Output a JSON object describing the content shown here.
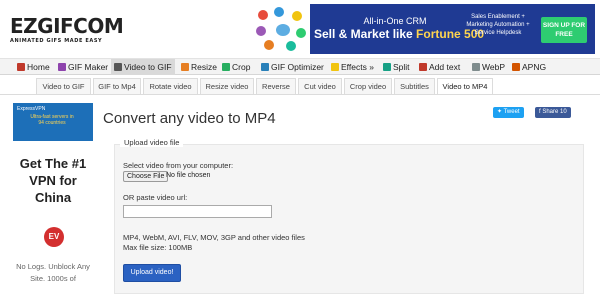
{
  "logo": {
    "text": "EZGIFCOM",
    "tagline": "ANIMATED GIFS MADE EASY"
  },
  "ad_banner": {
    "line1": "All-in-One CRM",
    "line2_prefix": "Sell & Market like ",
    "line2_highlight": "Fortune 500",
    "side_lines": [
      "Sales Enablement +",
      "Marketing Automation +",
      "Service Helpdesk"
    ],
    "cta": "SIGN UP FOR FREE",
    "colors": {
      "bg": "#1f3a93",
      "cta": "#2ecc71",
      "highlight": "#ffd54f"
    }
  },
  "main_nav": [
    {
      "label": "Home",
      "icon": "home-icon",
      "color": "#c0392b"
    },
    {
      "label": "GIF Maker",
      "icon": "gif-maker-icon",
      "color": "#8e44ad"
    },
    {
      "label": "Video to GIF",
      "icon": "video-icon",
      "color": "#555555",
      "active": true
    },
    {
      "label": "Resize",
      "icon": "resize-icon",
      "color": "#e67e22"
    },
    {
      "label": "Crop",
      "icon": "crop-icon",
      "color": "#27ae60"
    },
    {
      "label": "GIF Optimizer",
      "icon": "optimizer-icon",
      "color": "#2980b9"
    },
    {
      "label": "Effects »",
      "icon": "effects-icon",
      "color": "#f1c40f"
    },
    {
      "label": "Split",
      "icon": "split-icon",
      "color": "#16a085"
    },
    {
      "label": "Add text",
      "icon": "add-text-icon",
      "color": "#c0392b"
    },
    {
      "label": "WebP",
      "icon": "webp-icon",
      "color": "#7f8c8d"
    },
    {
      "label": "APNG",
      "icon": "apng-icon",
      "color": "#d35400"
    }
  ],
  "sub_nav": [
    {
      "label": "Video to GIF"
    },
    {
      "label": "GIF to Mp4"
    },
    {
      "label": "Rotate video"
    },
    {
      "label": "Resize video"
    },
    {
      "label": "Reverse"
    },
    {
      "label": "Cut video"
    },
    {
      "label": "Crop video"
    },
    {
      "label": "Subtitles"
    },
    {
      "label": "Video to MP4",
      "active": true
    }
  ],
  "side_ad": {
    "thumb_title": "ExpressVPN",
    "thumb_text": "Ultra-fast servers in 94 countries",
    "headline": "Get The #1 VPN for China",
    "badge": "EV",
    "footer": "No Logs. Unblock Any Site. 1000s of"
  },
  "page_title": "Convert any video to MP4",
  "share": {
    "tweet": "Tweet",
    "facebook": "Share 10"
  },
  "upload": {
    "legend": "Upload video file",
    "select_label": "Select video from your computer:",
    "choose_file": "Choose File",
    "no_file": "No file chosen",
    "url_label": "OR paste video url:",
    "url_value": "",
    "formats": "MP4, WebM, AVI, FLV, MOV, 3GP and other video files",
    "max_size": "Max file size: 100MB",
    "button": "Upload video!"
  }
}
